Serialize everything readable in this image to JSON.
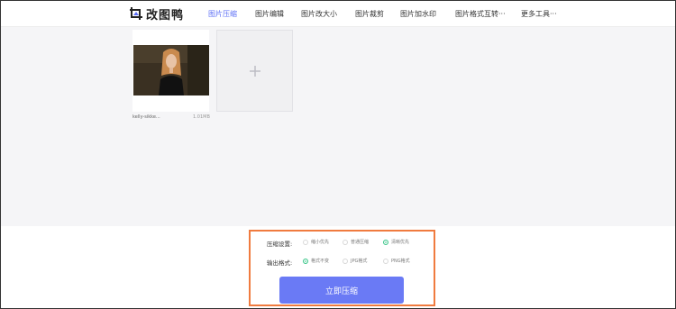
{
  "header": {
    "logo_text": "改图鸭",
    "nav": [
      {
        "label": "图片压缩",
        "active": true
      },
      {
        "label": "图片编辑",
        "active": false
      },
      {
        "label": "图片改大小",
        "active": false
      },
      {
        "label": "图片裁剪",
        "active": false
      },
      {
        "label": "图片加水印",
        "active": false
      },
      {
        "label": "图片格式互转···",
        "active": false
      },
      {
        "label": "更多工具···",
        "active": false
      }
    ]
  },
  "uploads": [
    {
      "file_name": "kelly-sikke...",
      "file_size": "1.01MB"
    }
  ],
  "add_button_icon": "plus-icon",
  "settings": {
    "compress_label": "压缩设置:",
    "compress_options": [
      {
        "label": "缩小优先",
        "selected": false
      },
      {
        "label": "普通压缩",
        "selected": false
      },
      {
        "label": "清晰优先",
        "selected": true
      }
    ],
    "format_label": "输出格式:",
    "format_options": [
      {
        "label": "格式不变",
        "selected": true
      },
      {
        "label": "JPG格式",
        "selected": false
      },
      {
        "label": "PNG格式",
        "selected": false
      }
    ],
    "submit_label": "立即压缩"
  },
  "colors": {
    "accent": "#5b6ef5",
    "button": "#6a7af5",
    "highlight_border": "#f07b3f",
    "radio_selected": "#3cc68a"
  }
}
